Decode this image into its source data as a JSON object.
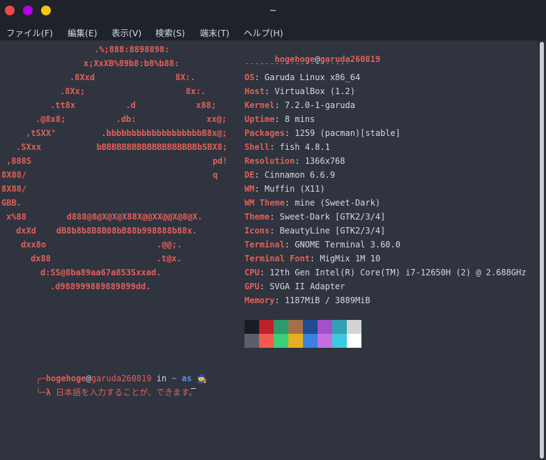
{
  "window": {
    "title": "~",
    "colors": {
      "close": "#e94b4b",
      "minimize": "#b200e6",
      "maximize": "#f5c515"
    }
  },
  "menu": [
    "ファイル(F)",
    "編集(E)",
    "表示(V)",
    "検索(S)",
    "端末(T)",
    "ヘルプ(H)"
  ],
  "ascii_art": [
    ".%;888:8898898:",
    "x;XxXB%89b8:b8%b88:",
    ".8Xxd                8X:.",
    ".8Xx;                    8x:.",
    ".tt8x          .d            x88;",
    ".@8x8;          .db:              xx@;",
    ",tSXX°         .bbbbbbbbbbbbbbbbbbbB8x@;",
    ".SXxx           bBBBBBBBBBBBBBBBBBBBbSBX8;",
    ",888S                                    pd!",
    "8X88/                                     q",
    "8X88/",
    "GBB.",
    "x%88        d888@8@X@X@X88X@@XX@@X@8@X.",
    "dxXd    dB8b8b8B8B08bB88b998888b88x.",
    "dxx8o                      .@@;.",
    "dx88                     .t@x.",
    "d:SS@8ba89aa67a853Sxxad.",
    ".d988999889889899dd."
  ],
  "sysinfo": {
    "user": "hogehoge",
    "at": "@",
    "host": "garuda260819",
    "separator": "---------------------",
    "fields": [
      {
        "key": "OS",
        "value": "Garuda Linux x86_64"
      },
      {
        "key": "Host",
        "value": "VirtualBox (1.2)"
      },
      {
        "key": "Kernel",
        "value": "7.2.0-1-garuda"
      },
      {
        "key": "Uptime",
        "value": "8 mins"
      },
      {
        "key": "Packages",
        "value": "1259 (pacman)[stable]"
      },
      {
        "key": "Shell",
        "value": "fish 4.8.1"
      },
      {
        "key": "Resolution",
        "value": "1366x768"
      },
      {
        "key": "DE",
        "value": "Cinnamon 6.6.9"
      },
      {
        "key": "WM",
        "value": "Muffin (X11)"
      },
      {
        "key": "WM Theme",
        "value": "mine (Sweet-Dark)"
      },
      {
        "key": "Theme",
        "value": "Sweet-Dark [GTK2/3/4]"
      },
      {
        "key": "Icons",
        "value": "BeautyLine [GTK2/3/4]"
      },
      {
        "key": "Terminal",
        "value": "GNOME Terminal 3.60.0"
      },
      {
        "key": "Terminal Font",
        "value": "MigMix 1M 10"
      },
      {
        "key": "CPU",
        "value": "12th Gen Intel(R) Core(TM) i7-12650H (2) @ 2.688GHz"
      },
      {
        "key": "GPU",
        "value": "SVGA II Adapter"
      },
      {
        "key": "Memory",
        "value": "1187MiB / 3889MiB"
      }
    ],
    "palette_row1": [
      "#1b1b24",
      "#c0202a",
      "#2e9c6a",
      "#a3704a",
      "#1f4c8f",
      "#a64fcd",
      "#30a2b4",
      "#d3d3d3"
    ],
    "palette_row2": [
      "#5e5e6a",
      "#f55a50",
      "#3ccf7a",
      "#e5b01e",
      "#3a82e0",
      "#c670e0",
      "#3ec8e0",
      "#ffffff"
    ]
  },
  "prompt": {
    "user": "hogehoge",
    "at": "@",
    "host": "garuda260819",
    "in": " in ",
    "dir": "~",
    "as": " as",
    "lambda": "λ",
    "input": "日本語を入力することが、できます。"
  }
}
